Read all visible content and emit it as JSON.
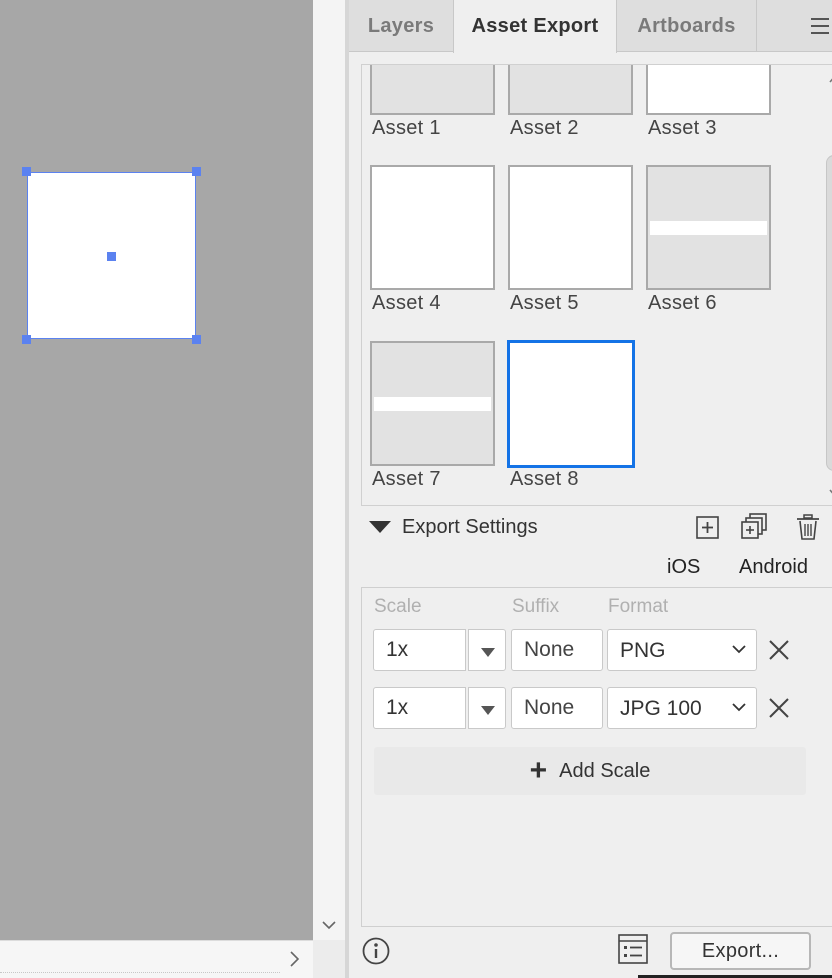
{
  "tabs": [
    {
      "label": "Layers"
    },
    {
      "label": "Asset Export"
    },
    {
      "label": "Artboards"
    }
  ],
  "assets": [
    {
      "label": "Asset 1"
    },
    {
      "label": "Asset 2"
    },
    {
      "label": "Asset 3"
    },
    {
      "label": "Asset 4"
    },
    {
      "label": "Asset 5"
    },
    {
      "label": "Asset 6"
    },
    {
      "label": "Asset 7"
    },
    {
      "label": "Asset 8"
    }
  ],
  "export_settings": {
    "title": "Export Settings",
    "presets": {
      "ios": "iOS",
      "android": "Android"
    },
    "columns": {
      "scale": "Scale",
      "suffix": "Suffix",
      "format": "Format"
    },
    "rows": [
      {
        "scale": "1x",
        "suffix": "None",
        "format": "PNG"
      },
      {
        "scale": "1x",
        "suffix": "None",
        "format": "JPG 100"
      }
    ],
    "add_scale": "Add Scale"
  },
  "footer": {
    "export_button": "Export..."
  },
  "colors": {
    "selection": "#5b82f0",
    "selected_asset": "#1473e6"
  }
}
